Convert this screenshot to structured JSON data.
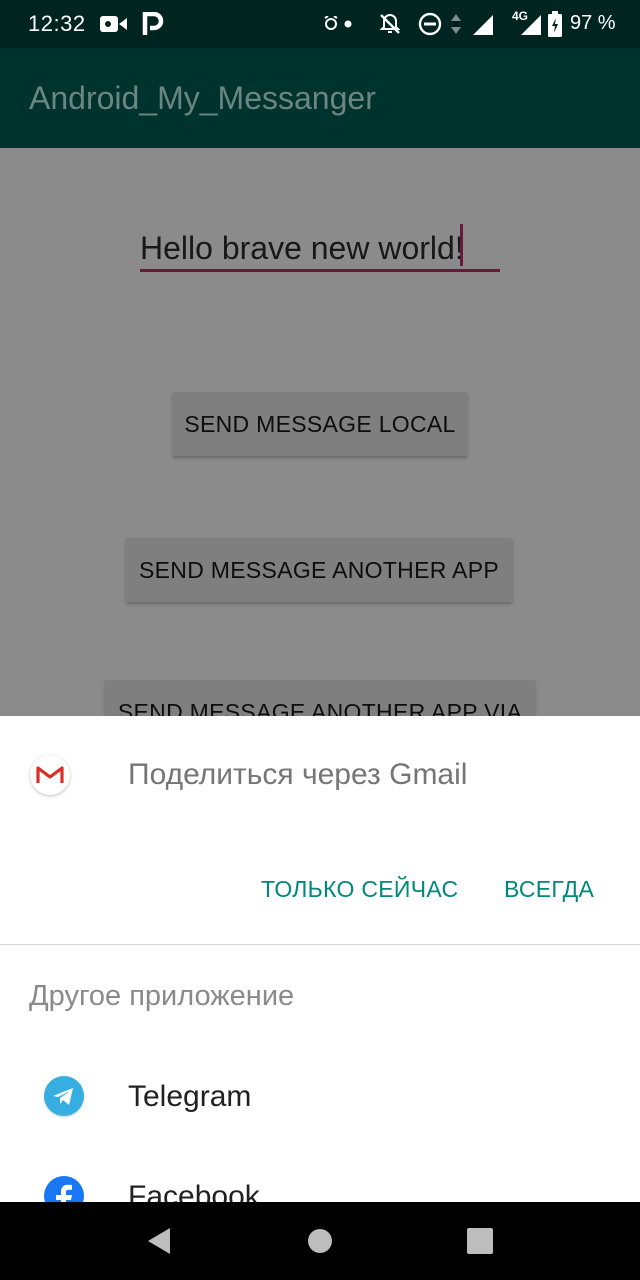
{
  "status_bar": {
    "time": "12:32",
    "network": "4G",
    "battery": "97 %",
    "icons": [
      "video-camera-icon",
      "p-notification-icon",
      "alarm-icon",
      "dot-icon",
      "notifications-off-icon",
      "do-not-disturb-icon",
      "data-arrows-icon",
      "wifi-icon",
      "signal-icon",
      "battery-icon"
    ]
  },
  "app_bar": {
    "title": "Android_My_Messanger"
  },
  "main": {
    "message_value": "Hello brave new world!",
    "buttons": {
      "send_local": "SEND MESSAGE LOCAL",
      "send_another_app": "SEND MESSAGE ANOTHER APP",
      "send_another_app_via": "SEND MESSAGE ANOTHER APP VIA"
    }
  },
  "share_sheet": {
    "title": "Поделиться через Gmail",
    "just_once": "ТОЛЬКО СЕЙЧАС",
    "always": "ВСЕГДА",
    "other_app_heading": "Другое приложение",
    "apps": [
      {
        "name": "Telegram",
        "icon": "telegram-icon"
      },
      {
        "name": "Facebook",
        "icon": "facebook-icon"
      }
    ]
  },
  "nav_bar": {
    "icons": [
      "back-icon",
      "home-icon",
      "recents-icon"
    ]
  },
  "colors": {
    "app_bar": "#00332e",
    "status_bar": "#002420",
    "accent": "#00897b",
    "input_underline": "#6d1739",
    "scrim_content": "#8b8b8b"
  }
}
